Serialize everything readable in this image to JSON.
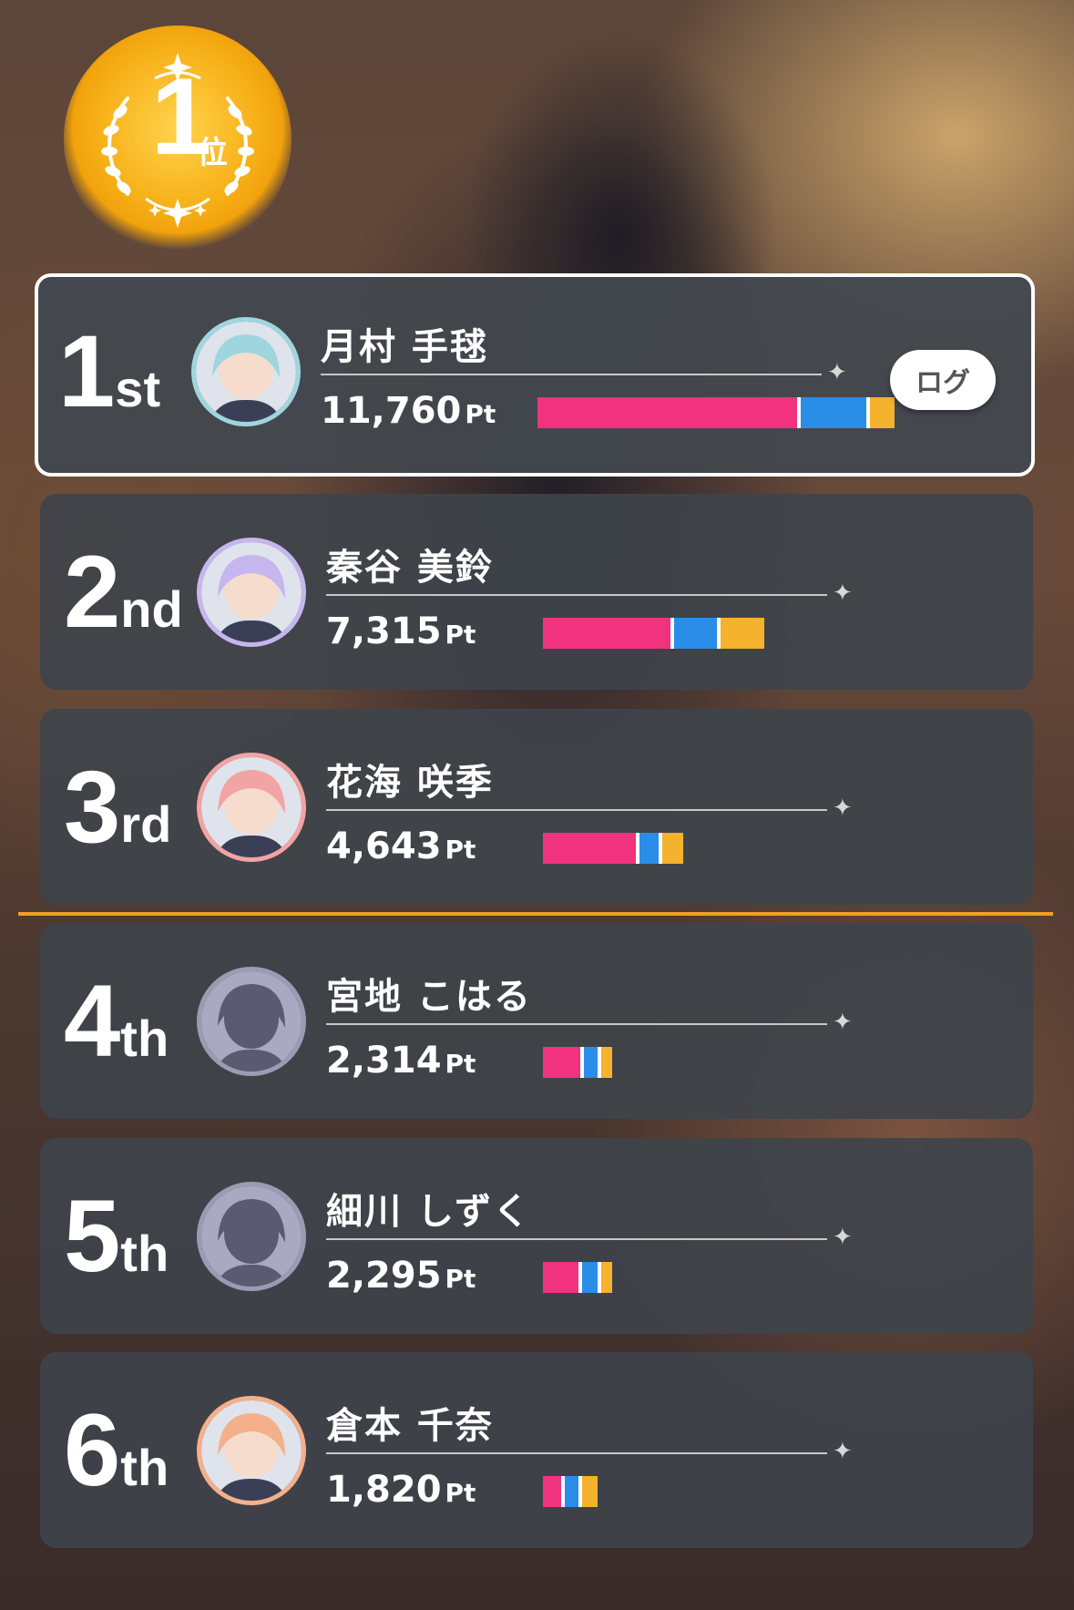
{
  "rank_badge": {
    "number": "1",
    "suffix": "位"
  },
  "colors": {
    "bar_pink": "#f0327f",
    "bar_blue": "#2a8de8",
    "bar_orange": "#f4b22e",
    "cutoff_line": "#f0a020",
    "badge_gold": "#f5b01a"
  },
  "log_button": {
    "label": "ログ"
  },
  "players": [
    {
      "place_num": "1",
      "place_suffix": "st",
      "name": "月村 手毬",
      "score": "11,760",
      "unit": "Pt",
      "avatar_border": "#9fd6de",
      "avatar_icon": "character-portrait",
      "segments": [
        0.733,
        0.19,
        0.077
      ],
      "bar_fraction": 1.0
    },
    {
      "place_num": "2",
      "place_suffix": "nd",
      "name": "秦谷 美鈴",
      "score": "7,315",
      "unit": "Pt",
      "avatar_border": "#c6b6ef",
      "avatar_icon": "character-portrait",
      "segments": [
        0.585,
        0.205,
        0.21
      ],
      "bar_fraction": 0.622
    },
    {
      "place_num": "3",
      "place_suffix": "rd",
      "name": "花海 咲季",
      "score": "4,643",
      "unit": "Pt",
      "avatar_border": "#f2a3a3",
      "avatar_icon": "character-portrait",
      "segments": [
        0.675,
        0.155,
        0.17
      ],
      "bar_fraction": 0.395
    },
    {
      "place_num": "4",
      "place_suffix": "th",
      "name": "宮地 こはる",
      "score": "2,314",
      "unit": "Pt",
      "avatar_border": "#9b9bb4",
      "avatar_icon": "silhouette",
      "segments": [
        0.57,
        0.23,
        0.2
      ],
      "bar_fraction": 0.197
    },
    {
      "place_num": "5",
      "place_suffix": "th",
      "name": "細川 しずく",
      "score": "2,295",
      "unit": "Pt",
      "avatar_border": "#9b9bb4",
      "avatar_icon": "silhouette",
      "segments": [
        0.54,
        0.26,
        0.2
      ],
      "bar_fraction": 0.195
    },
    {
      "place_num": "6",
      "place_suffix": "th",
      "name": "倉本 千奈",
      "score": "1,820",
      "unit": "Pt",
      "avatar_border": "#f4b08a",
      "avatar_icon": "character-portrait",
      "segments": [
        0.38,
        0.3,
        0.32
      ],
      "bar_fraction": 0.155
    }
  ]
}
